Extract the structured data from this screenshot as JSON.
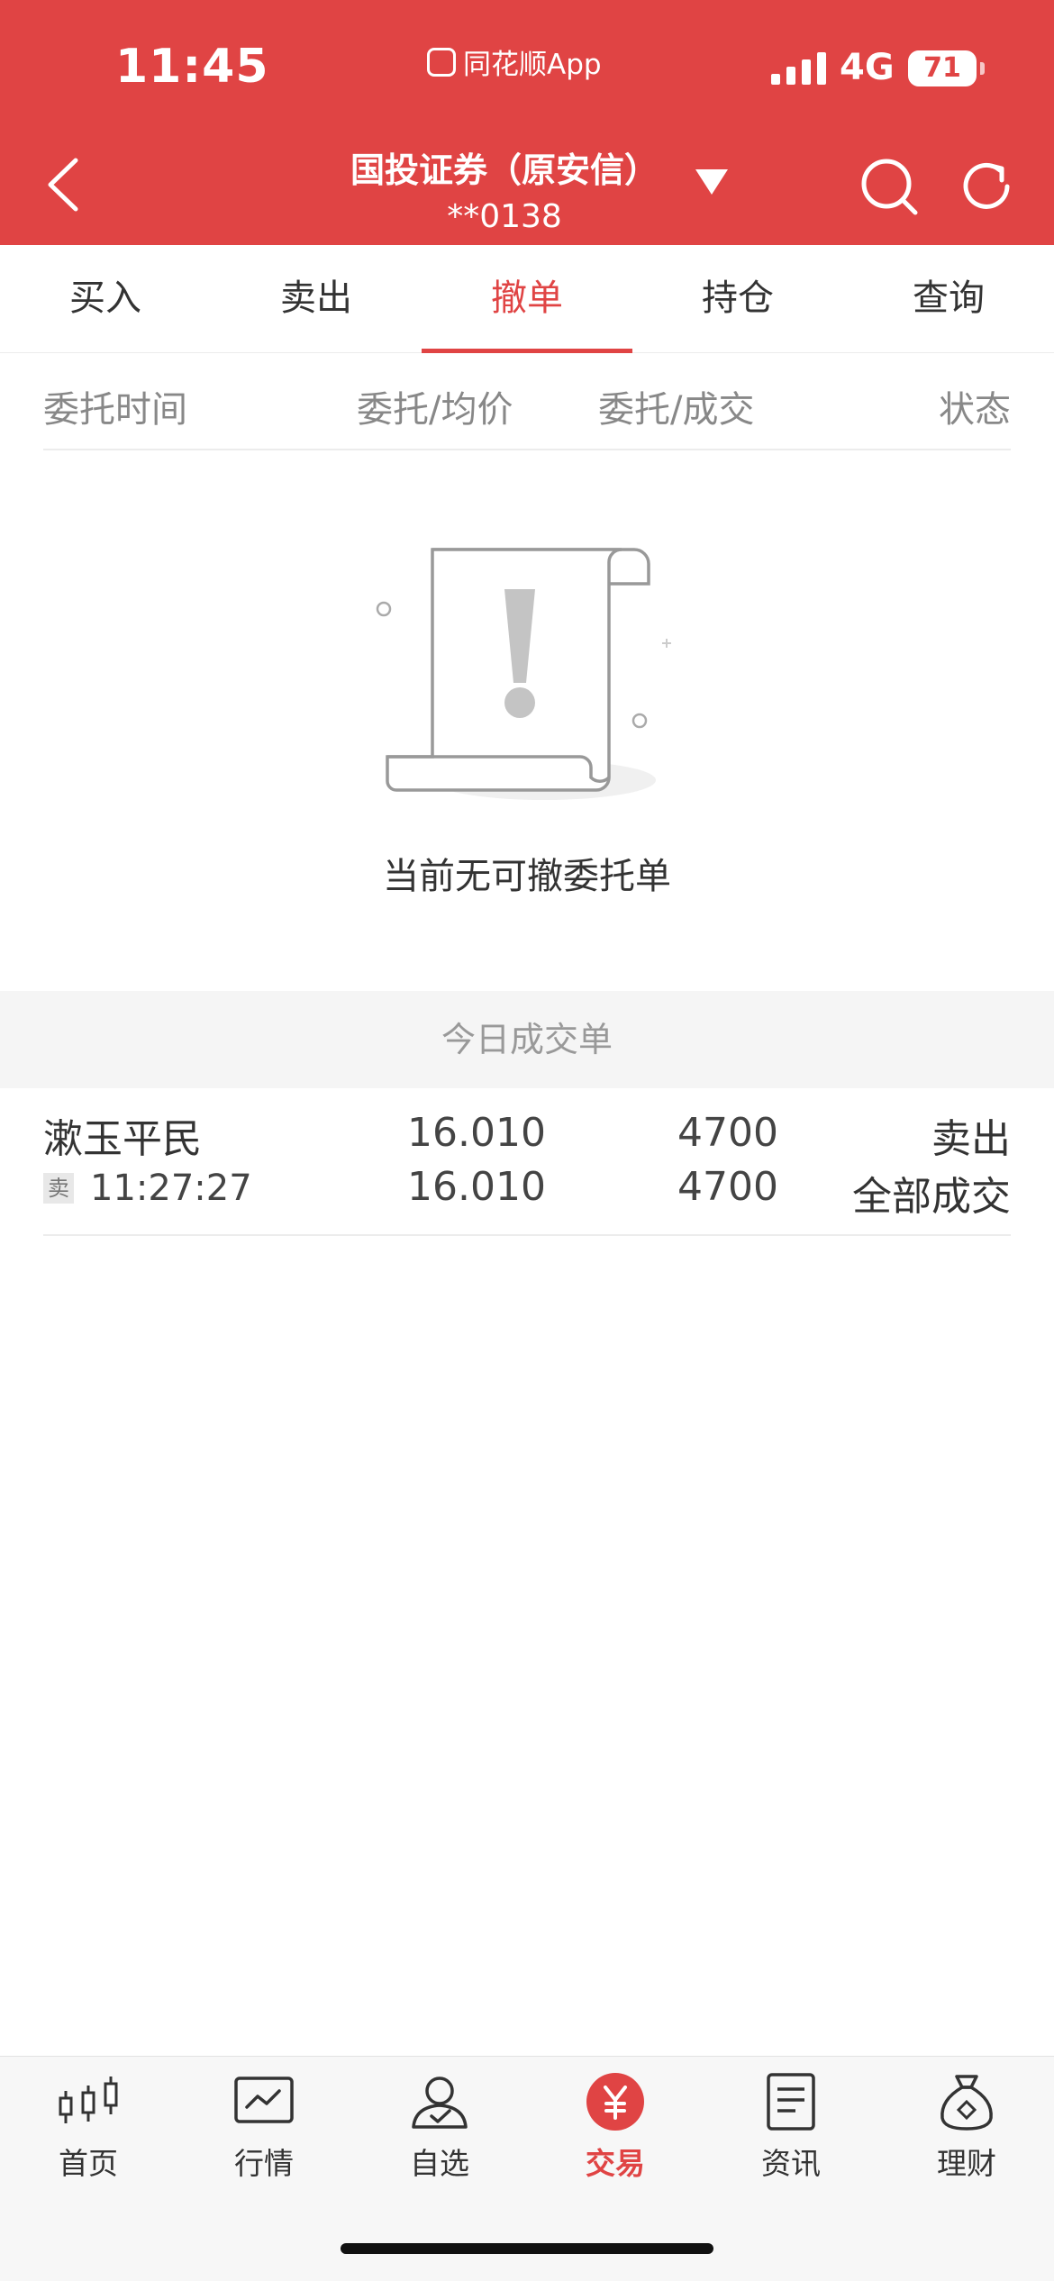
{
  "status_bar": {
    "time": "11:45",
    "app_name": "同花顺App",
    "network": "4G",
    "battery": "71"
  },
  "header": {
    "title": "国投证券（原安信）",
    "account": "**0138"
  },
  "tabs": [
    {
      "label": "买入"
    },
    {
      "label": "卖出"
    },
    {
      "label": "撤单",
      "active": true
    },
    {
      "label": "持仓"
    },
    {
      "label": "查询"
    }
  ],
  "columns": {
    "time": "委托时间",
    "price": "委托/均价",
    "qty": "委托/成交",
    "status": "状态"
  },
  "empty_state": {
    "message": "当前无可撤委托单"
  },
  "today_deals": {
    "title": "今日成交单",
    "rows": [
      {
        "stock_name": "漱玉平民",
        "side_badge": "卖",
        "time": "11:27:27",
        "order_price": "16.010",
        "avg_price": "16.010",
        "order_qty": "4700",
        "filled_qty": "4700",
        "direction": "卖出",
        "status": "全部成交"
      }
    ]
  },
  "bottom_nav": [
    {
      "label": "首页",
      "icon": "candlestick-icon"
    },
    {
      "label": "行情",
      "icon": "chart-icon"
    },
    {
      "label": "自选",
      "icon": "user-check-icon"
    },
    {
      "label": "交易",
      "icon": "yuan-icon",
      "active": true
    },
    {
      "label": "资讯",
      "icon": "document-icon"
    },
    {
      "label": "理财",
      "icon": "money-bag-icon"
    }
  ],
  "colors": {
    "brand_red": "#e04444",
    "text": "#333333",
    "muted": "#888888"
  }
}
